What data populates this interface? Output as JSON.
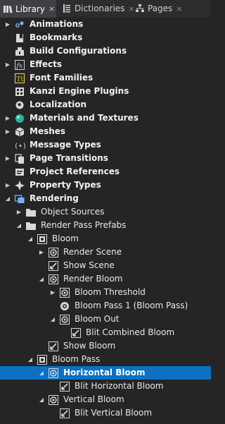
{
  "tabs": [
    {
      "label": "Library",
      "active": true
    },
    {
      "label": "Dictionaries",
      "active": false
    },
    {
      "label": "Pages",
      "active": false
    }
  ],
  "tab_close_glyph": "×",
  "arrows": {
    "collapsed": "▶",
    "expanded": "◢"
  },
  "tree": [
    {
      "label": "Animations",
      "depth": 0,
      "arrow": "collapsed",
      "icon": "animation-icon",
      "bold": true
    },
    {
      "label": "Bookmarks",
      "depth": 0,
      "arrow": "none",
      "icon": "bookmark-icon",
      "bold": true
    },
    {
      "label": "Build Configurations",
      "depth": 0,
      "arrow": "none",
      "icon": "build-config-icon",
      "bold": true
    },
    {
      "label": "Effects",
      "depth": 0,
      "arrow": "collapsed",
      "icon": "effects-icon",
      "bold": true
    },
    {
      "label": "Font Families",
      "depth": 0,
      "arrow": "none",
      "icon": "font-icon",
      "bold": true
    },
    {
      "label": "Kanzi Engine Plugins",
      "depth": 0,
      "arrow": "none",
      "icon": "plugin-icon",
      "bold": true
    },
    {
      "label": "Localization",
      "depth": 0,
      "arrow": "none",
      "icon": "localization-icon",
      "bold": true
    },
    {
      "label": "Materials and Textures",
      "depth": 0,
      "arrow": "collapsed",
      "icon": "material-icon",
      "bold": true
    },
    {
      "label": "Meshes",
      "depth": 0,
      "arrow": "collapsed",
      "icon": "mesh-icon",
      "bold": true
    },
    {
      "label": "Message Types",
      "depth": 0,
      "arrow": "none",
      "icon": "message-icon",
      "bold": true
    },
    {
      "label": "Page Transitions",
      "depth": 0,
      "arrow": "collapsed",
      "icon": "page-transition-icon",
      "bold": true
    },
    {
      "label": "Project References",
      "depth": 0,
      "arrow": "none",
      "icon": "reference-icon",
      "bold": true
    },
    {
      "label": "Property Types",
      "depth": 0,
      "arrow": "collapsed",
      "icon": "property-icon",
      "bold": true
    },
    {
      "label": "Rendering",
      "depth": 0,
      "arrow": "expanded",
      "icon": "rendering-icon",
      "bold": true
    },
    {
      "label": "Object Sources",
      "depth": 1,
      "arrow": "collapsed",
      "icon": "folder-icon",
      "bold": false
    },
    {
      "label": "Render Pass Prefabs",
      "depth": 1,
      "arrow": "expanded",
      "icon": "folder-icon",
      "bold": false
    },
    {
      "label": "Bloom",
      "depth": 2,
      "arrow": "expanded",
      "icon": "prefab-icon",
      "bold": false
    },
    {
      "label": "Render Scene",
      "depth": 3,
      "arrow": "collapsed",
      "icon": "render-pass-icon",
      "bold": false
    },
    {
      "label": "Show Scene",
      "depth": 3,
      "arrow": "none",
      "icon": "blit-icon",
      "bold": false
    },
    {
      "label": "Render Bloom",
      "depth": 3,
      "arrow": "expanded",
      "icon": "render-pass-icon",
      "bold": false
    },
    {
      "label": "Bloom Threshold",
      "depth": 4,
      "arrow": "collapsed",
      "icon": "render-pass-icon",
      "bold": false
    },
    {
      "label": "Bloom Pass 1 (Bloom Pass)",
      "depth": 4,
      "arrow": "none",
      "icon": "bloom-pass-icon",
      "bold": false
    },
    {
      "label": "Bloom Out",
      "depth": 4,
      "arrow": "expanded",
      "icon": "render-pass-icon",
      "bold": false
    },
    {
      "label": "Blit Combined Bloom",
      "depth": 5,
      "arrow": "none",
      "icon": "blit-icon",
      "bold": false
    },
    {
      "label": "Show Bloom",
      "depth": 3,
      "arrow": "none",
      "icon": "blit-icon",
      "bold": false
    },
    {
      "label": "Bloom Pass",
      "depth": 2,
      "arrow": "expanded",
      "icon": "prefab-icon",
      "bold": false
    },
    {
      "label": "Horizontal Bloom",
      "depth": 3,
      "arrow": "expanded",
      "icon": "render-pass-icon",
      "bold": false,
      "selected": true
    },
    {
      "label": "Blit Horizontal Bloom",
      "depth": 4,
      "arrow": "none",
      "icon": "blit-icon",
      "bold": false
    },
    {
      "label": "Vertical Bloom",
      "depth": 3,
      "arrow": "expanded",
      "icon": "render-pass-icon",
      "bold": false
    },
    {
      "label": "Blit Vertical Bloom",
      "depth": 4,
      "arrow": "none",
      "icon": "blit-icon",
      "bold": false
    }
  ],
  "colors": {
    "panel_bg": "#252526",
    "tab_active_bg": "#3f3f46",
    "selection": "#0e70c0"
  }
}
